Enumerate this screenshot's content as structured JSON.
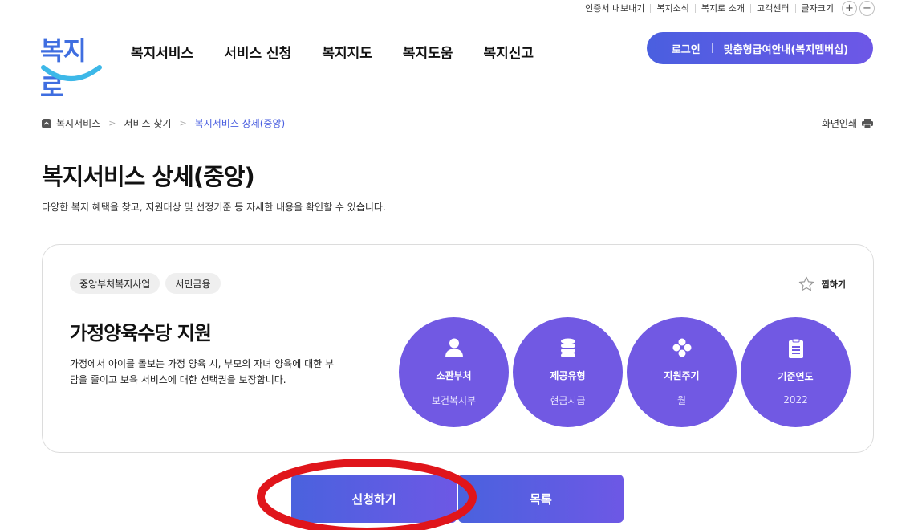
{
  "util_bar": {
    "items": [
      "인증서 내보내기",
      "복지소식",
      "복지로 소개",
      "고객센터",
      "글자크기"
    ],
    "zoom_in": "+",
    "zoom_out": "−"
  },
  "header": {
    "logo_text": "복지로",
    "nav": [
      "복지서비스",
      "서비스 신청",
      "복지지도",
      "복지도움",
      "복지신고"
    ],
    "login_label": "로그인",
    "membership_label": "맞춤형급여안내(복지멤버십)"
  },
  "breadcrumb": {
    "items": [
      "복지서비스",
      "서비스 찾기",
      "복지서비스 상세(중앙)"
    ],
    "print_label": "화면인쇄"
  },
  "page": {
    "title": "복지서비스 상세(중앙)",
    "description": "다양한 복지 혜택을 찾고, 지원대상 및 선정기준 등 자세한 내용을 확인할 수 있습니다."
  },
  "service": {
    "tags": [
      "중앙부처복지사업",
      "서민금융"
    ],
    "favorite_label": "찜하기",
    "title": "가정양육수당 지원",
    "description": "가정에서 아이를 돌보는 가정 양육 시, 부모의 자녀 양육에 대한 부담을 줄이고 보육 서비스에 대한 선택권을 보장합니다.",
    "info": [
      {
        "icon": "person-icon",
        "label": "소관부처",
        "value": "보건복지부"
      },
      {
        "icon": "coins-icon",
        "label": "제공유형",
        "value": "현금지급"
      },
      {
        "icon": "cycle-icon",
        "label": "지원주기",
        "value": "월"
      },
      {
        "icon": "document-icon",
        "label": "기준연도",
        "value": "2022"
      }
    ]
  },
  "actions": {
    "apply_label": "신청하기",
    "list_label": "목록"
  },
  "colors": {
    "accent": "#7159e3",
    "brand_blue": "#4a5fe0",
    "highlight": "#e0151b"
  }
}
